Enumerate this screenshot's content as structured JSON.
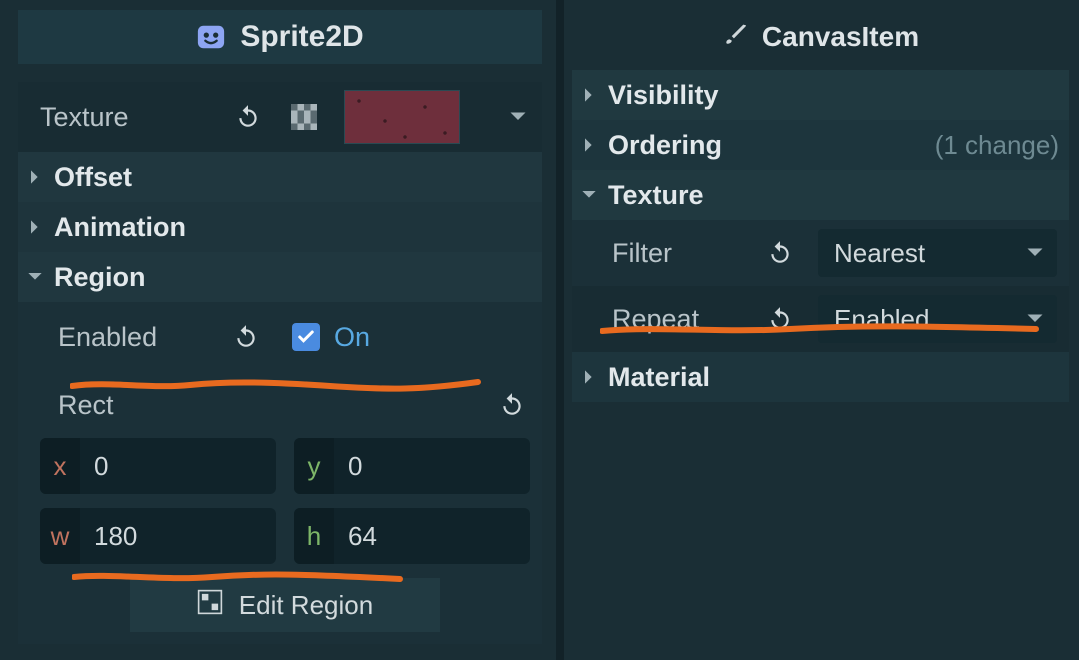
{
  "left": {
    "title": "Sprite2D",
    "texture_label": "Texture",
    "sections": {
      "offset": "Offset",
      "animation": "Animation",
      "region": "Region"
    },
    "region": {
      "enabled_label": "Enabled",
      "enabled_text": "On",
      "rect_label": "Rect",
      "rect": {
        "x": "0",
        "y": "0",
        "w": "180",
        "h": "64"
      },
      "edit_button": "Edit Region"
    }
  },
  "right": {
    "title": "CanvasItem",
    "sections": {
      "visibility": "Visibility",
      "ordering": "Ordering",
      "ordering_note": "(1 change)",
      "texture": "Texture",
      "material": "Material"
    },
    "texture": {
      "filter_label": "Filter",
      "filter_value": "Nearest",
      "repeat_label": "Repeat",
      "repeat_value": "Enabled"
    }
  }
}
